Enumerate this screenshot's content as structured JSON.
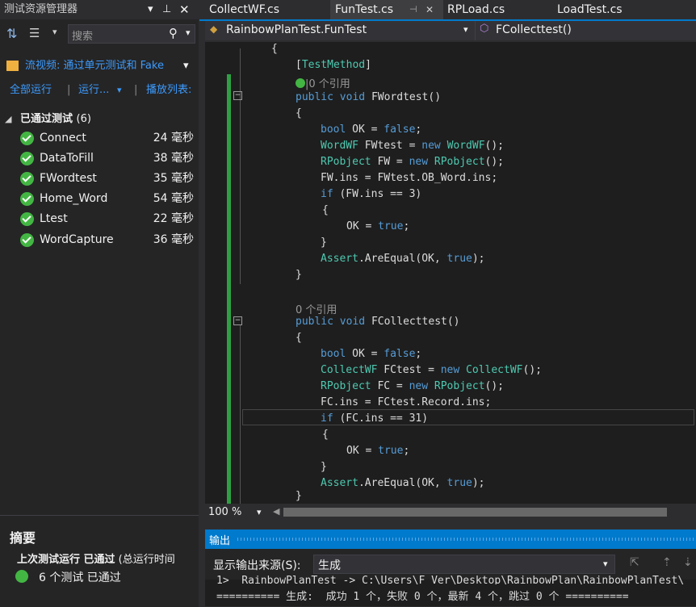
{
  "explorer": {
    "title": "测试资源管理器",
    "search_placeholder": "搜索",
    "playlist": "流视频: 通过单元测试和 Fake",
    "run_all": "全部运行",
    "run": "运行...",
    "playlist_menu": "播放列表:",
    "group": "已通过测试",
    "group_count": "(6)",
    "tests": [
      {
        "name": "Connect",
        "duration": "24 毫秒"
      },
      {
        "name": "DataToFill",
        "duration": "38 毫秒"
      },
      {
        "name": "FWordtest",
        "duration": "35 毫秒"
      },
      {
        "name": "Home_Word",
        "duration": "54 毫秒"
      },
      {
        "name": "Ltest",
        "duration": "22 毫秒"
      },
      {
        "name": "WordCapture",
        "duration": "36 毫秒"
      }
    ],
    "summary": {
      "title": "摘要",
      "last_run": "上次测试运行 已通过",
      "last_run_detail": "(总运行时间",
      "passed": "6 个测试 已通过"
    }
  },
  "tabs": [
    {
      "label": "CollectWF.cs"
    },
    {
      "label": "FunTest.cs"
    },
    {
      "label": "RPLoad.cs"
    },
    {
      "label": "LoadTest.cs"
    }
  ],
  "nav": {
    "class": "RainbowPlanTest.FunTest",
    "member": "FCollecttest()"
  },
  "code": {
    "l1": "{",
    "l2_attr": "TestMethod",
    "l3_ref": "|0 个引用",
    "l4a": "public",
    "l4b": "void",
    "l4c": "FWordtest()",
    "l5": "{",
    "l6a": "bool",
    "l6b": "OK =",
    "l6c": "false",
    "l6d": ";",
    "l7a": "WordWF",
    "l7b": "FWtest =",
    "l7c": "new",
    "l7d": "WordWF",
    "l7e": "();",
    "l8a": "RPobject",
    "l8b": "FW =",
    "l8c": "new",
    "l8d": "RPobject",
    "l8e": "();",
    "l9": "FW.ins = FWtest.OB_Word.ins;",
    "l10a": "if",
    "l10b": "(FW.ins == 3)",
    "l11": "{",
    "l12a": "OK =",
    "l12b": "true",
    "l12c": ";",
    "l13": "}",
    "l14a": "Assert",
    "l14b": ".AreEqual(OK,",
    "l14c": "true",
    "l14d": ");",
    "l15": "}",
    "l16_ref": "0 个引用",
    "l17a": "public",
    "l17b": "void",
    "l17c": "FCollecttest()",
    "l18": "{",
    "l19a": "bool",
    "l19b": "OK =",
    "l19c": "false",
    "l19d": ";",
    "l20a": "CollectWF",
    "l20b": "FCtest =",
    "l20c": "new",
    "l20d": "CollectWF",
    "l20e": "();",
    "l21a": "RPobject",
    "l21b": "FC =",
    "l21c": "new",
    "l21d": "RPobject",
    "l21e": "();",
    "l22": "FC.ins = FCtest.Record.ins;",
    "l23a": "if",
    "l23b": "(FC.ins == 31)",
    "l24": "{",
    "l25a": "OK =",
    "l25b": "true",
    "l25c": ";",
    "l26": "}",
    "l27a": "Assert",
    "l27b": ".AreEqual(OK,",
    "l27c": "true",
    "l27d": ");",
    "l28": "}"
  },
  "zoom": "100 %",
  "output": {
    "title": "输出",
    "source_label": "显示输出来源(S):",
    "source_value": "生成",
    "line1": "1>  RainbowPlanTest -> C:\\Users\\F_Ver\\Desktop\\RainbowPlan\\RainbowPlanTest\\",
    "line2": "========== 生成:  成功 1 个，失败 0 个，最新 4 个，跳过 0 个 =========="
  },
  "colors": {
    "accent": "#007acc",
    "pass": "#43b543",
    "link": "#3c9bfd"
  }
}
